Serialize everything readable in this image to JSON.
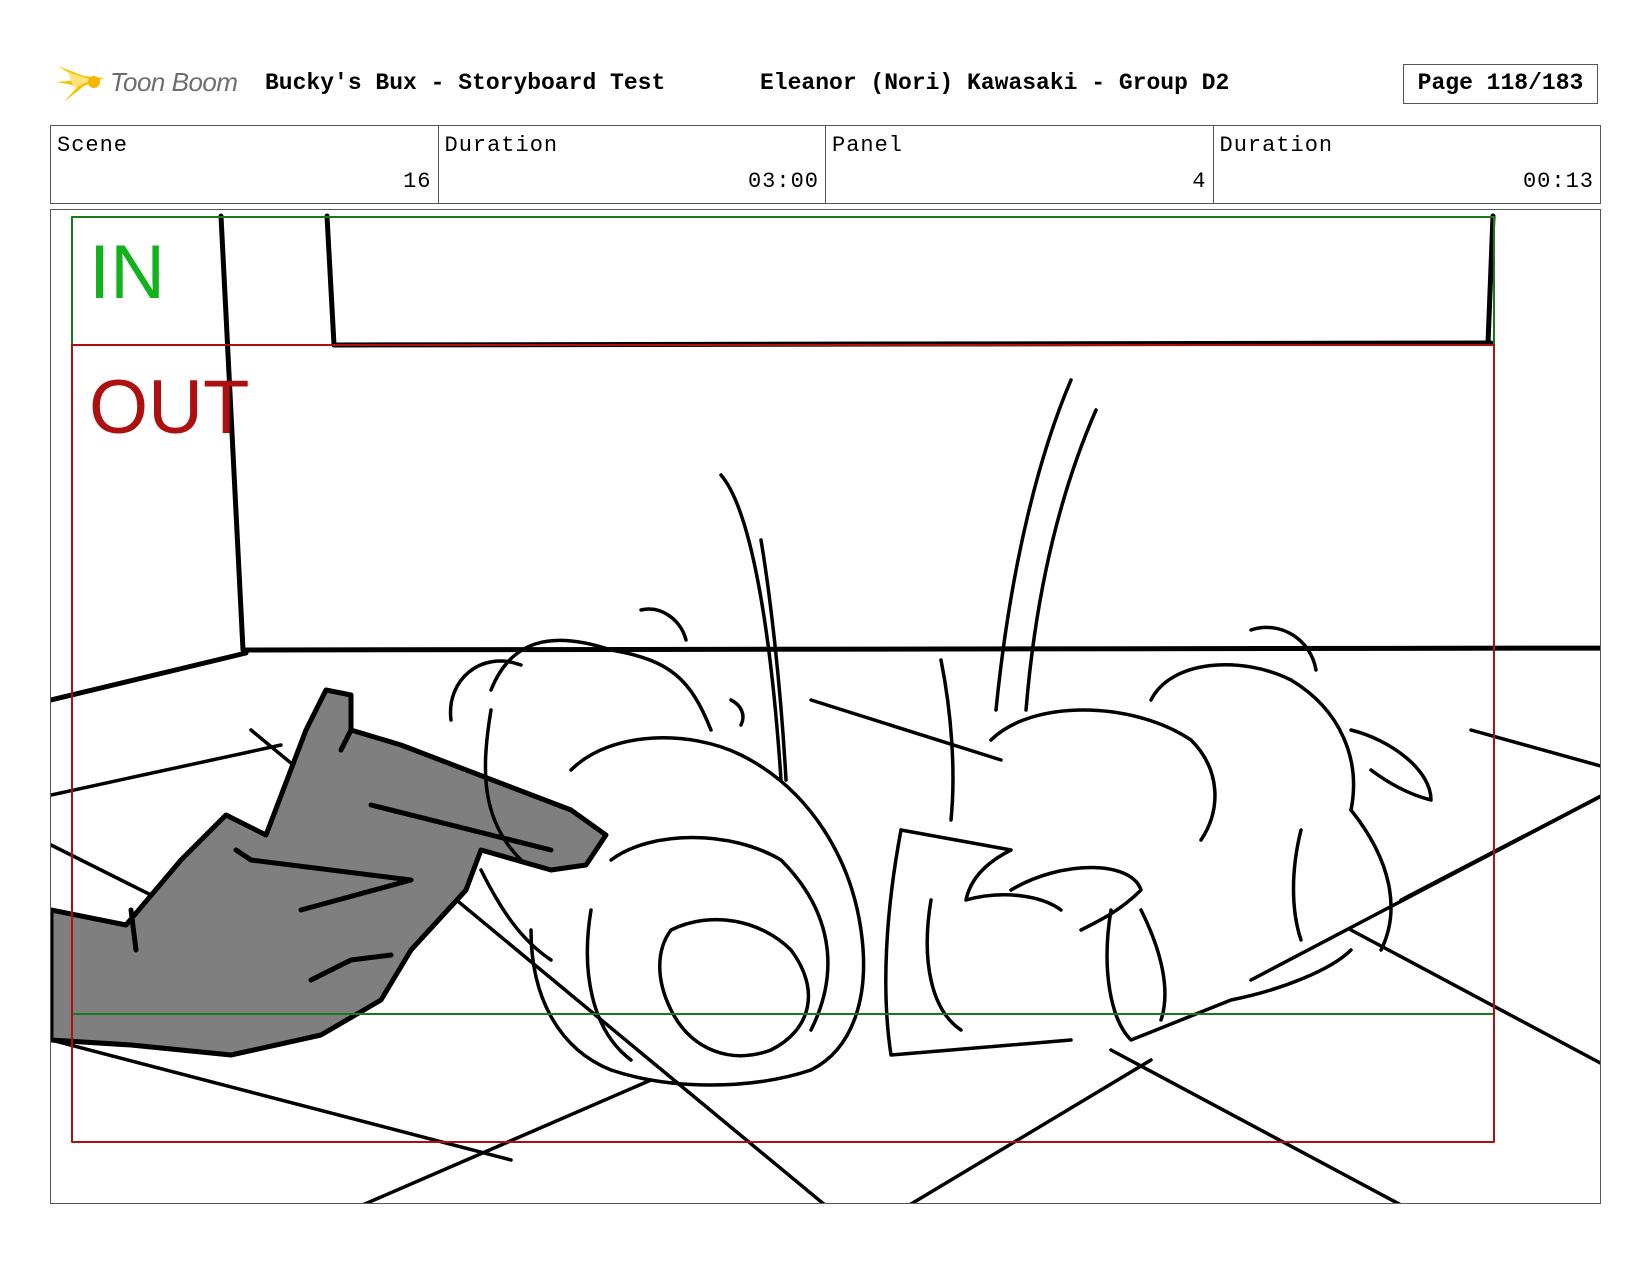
{
  "header": {
    "logo_text": "Toon Boom",
    "project_title": "Bucky's Bux - Storyboard Test",
    "artist": "Eleanor (Nori) Kawasaki - Group D2",
    "page": "Page 118/183"
  },
  "info": {
    "scene_label": "Scene",
    "scene_value": "16",
    "scene_duration_label": "Duration",
    "scene_duration_value": "03:00",
    "panel_label": "Panel",
    "panel_value": "4",
    "panel_duration_label": "Duration",
    "panel_duration_value": "00:13"
  },
  "panel": {
    "in_label": "IN",
    "out_label": "OUT"
  },
  "colors": {
    "in_frame": "#1a7a1a",
    "out_frame": "#ad1010",
    "hand_fill": "#7f7f7f",
    "logo_star": "#f5c400"
  }
}
